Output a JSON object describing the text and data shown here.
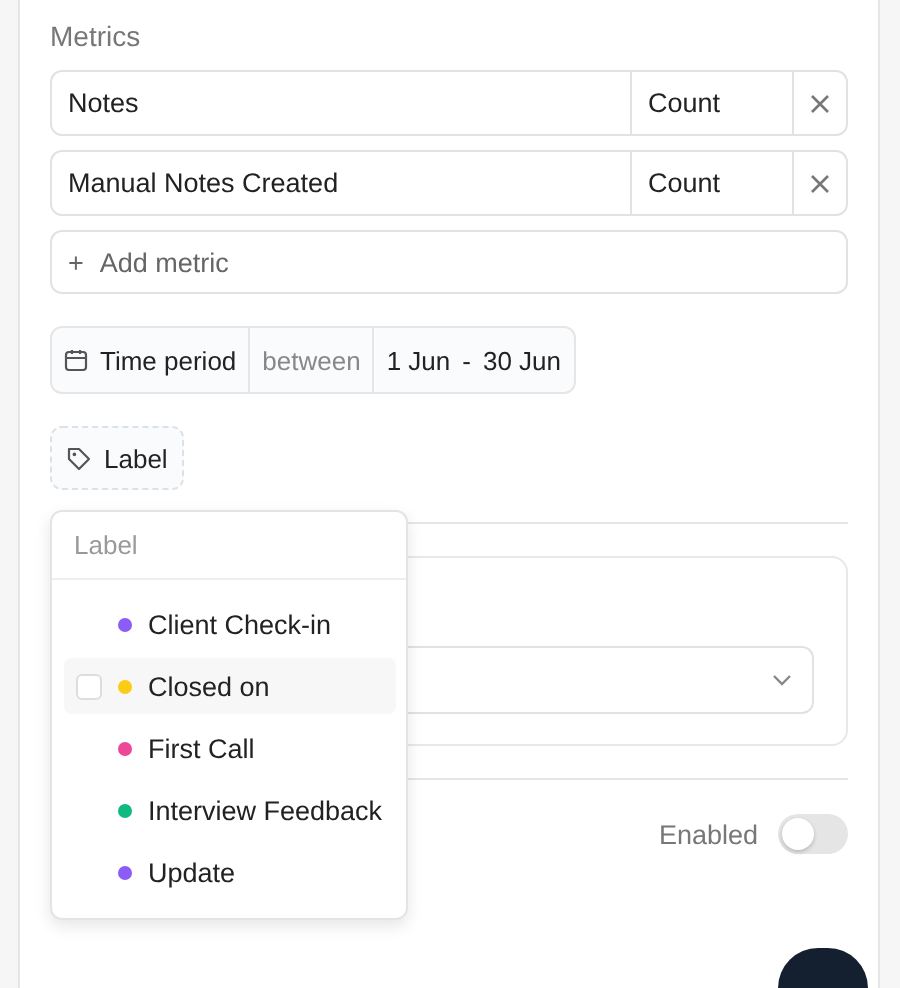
{
  "section_title": "Metrics",
  "metrics": [
    {
      "name": "Notes",
      "aggregation": "Count"
    },
    {
      "name": "Manual Notes Created",
      "aggregation": "Count"
    }
  ],
  "add_metric": {
    "icon": "+",
    "label": "Add metric"
  },
  "time_filter": {
    "label": "Time period",
    "operator": "between",
    "start": "1 Jun",
    "separator": "-",
    "end": "30 Jun"
  },
  "label_filter": {
    "label": "Label"
  },
  "label_dropdown": {
    "placeholder": "Label",
    "options": [
      {
        "label": "Client Check-in",
        "color": "#8b5cf6",
        "highlighted": false
      },
      {
        "label": "Closed on",
        "color": "#facc15",
        "highlighted": true
      },
      {
        "label": "First Call",
        "color": "#ec4899",
        "highlighted": false
      },
      {
        "label": "Interview Feedback",
        "color": "#10b981",
        "highlighted": false
      },
      {
        "label": "Update",
        "color": "#8b5cf6",
        "highlighted": false
      }
    ]
  },
  "enabled_toggle": {
    "label": "Enabled",
    "on": false
  }
}
